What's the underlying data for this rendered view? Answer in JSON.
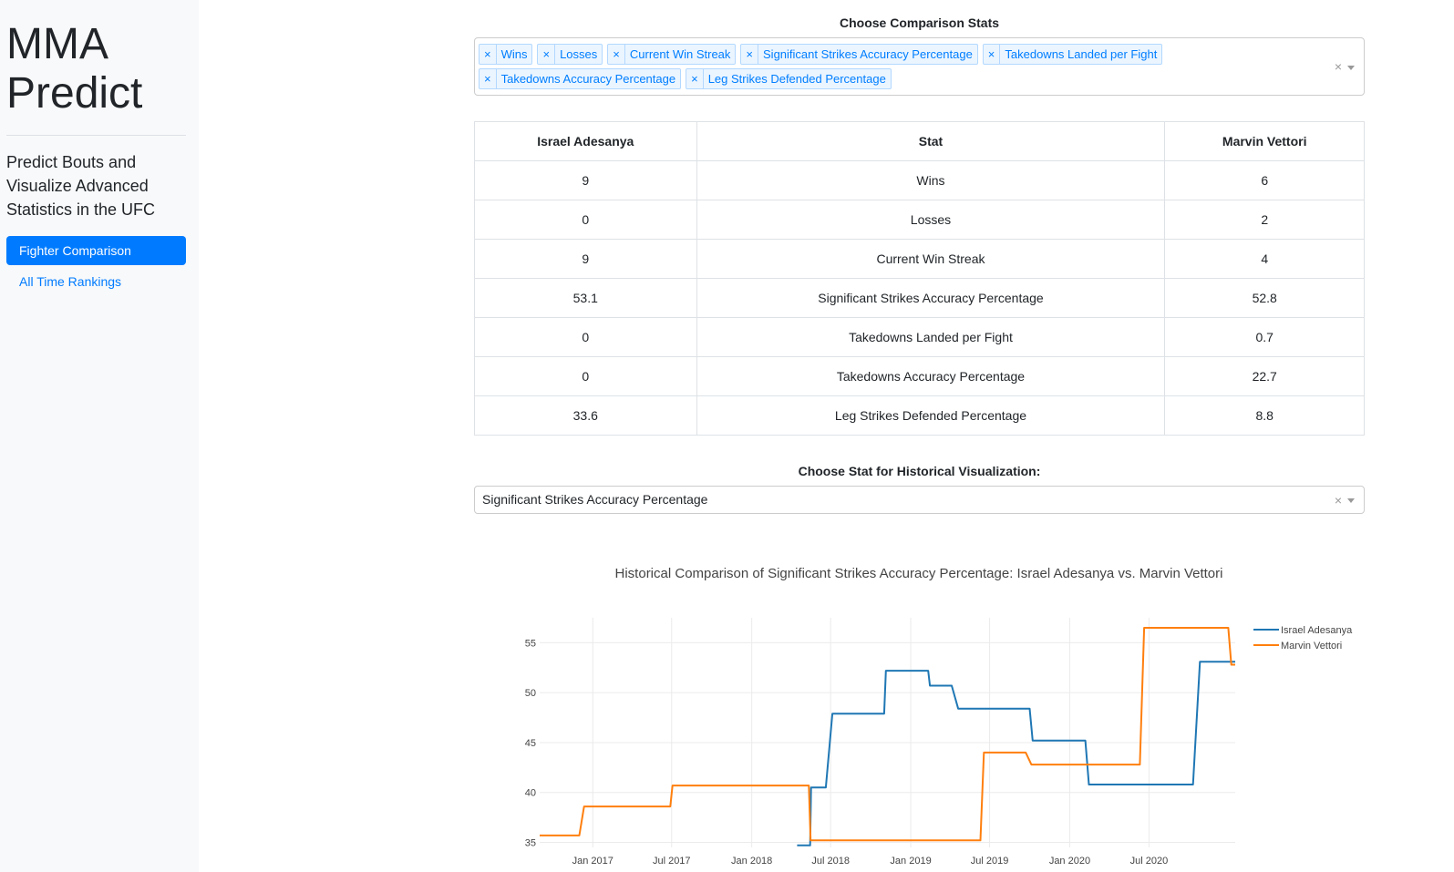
{
  "sidebar": {
    "title_line1": "MMA",
    "title_line2": "Predict",
    "tagline": "Predict Bouts and Visualize Advanced Statistics in the UFC",
    "nav": [
      {
        "label": "Fighter Comparison",
        "active": true
      },
      {
        "label": "All Time Rankings",
        "active": false
      }
    ]
  },
  "comparison": {
    "label": "Choose Comparison Stats",
    "selected": [
      "Wins",
      "Losses",
      "Current Win Streak",
      "Significant Strikes Accuracy Percentage",
      "Takedowns Landed per Fight",
      "Takedowns Accuracy Percentage",
      "Leg Strikes Defended Percentage"
    ],
    "clear_icon": "×"
  },
  "table": {
    "headers": [
      "Israel Adesanya",
      "Stat",
      "Marvin Vettori"
    ],
    "rows": [
      [
        "9",
        "Wins",
        "6"
      ],
      [
        "0",
        "Losses",
        "2"
      ],
      [
        "9",
        "Current Win Streak",
        "4"
      ],
      [
        "53.1",
        "Significant Strikes Accuracy Percentage",
        "52.8"
      ],
      [
        "0",
        "Takedowns Landed per Fight",
        "0.7"
      ],
      [
        "0",
        "Takedowns Accuracy Percentage",
        "22.7"
      ],
      [
        "33.6",
        "Leg Strikes Defended Percentage",
        "8.8"
      ]
    ]
  },
  "historical": {
    "label": "Choose Stat for Historical Visualization:",
    "selected": "Significant Strikes Accuracy Percentage"
  },
  "chart_data": {
    "type": "line",
    "title": "Historical Comparison of Significant Strikes Accuracy Percentage: Israel Adesanya vs. Marvin Vettori",
    "xlabel": "",
    "ylabel": "",
    "x_range": [
      "2016-09-01",
      "2021-01-15"
    ],
    "ylim": [
      34.5,
      57.5
    ],
    "x_ticks": [
      "Jan 2017",
      "Jul 2017",
      "Jan 2018",
      "Jul 2018",
      "Jan 2019",
      "Jul 2019",
      "Jan 2020",
      "Jul 2020"
    ],
    "y_ticks": [
      35,
      40,
      45,
      50,
      55
    ],
    "grid": true,
    "legend": "top-right",
    "series": [
      {
        "name": "Israel Adesanya",
        "color": "#1f77b4",
        "points": [
          [
            "2018-04-15",
            34.7
          ],
          [
            "2018-05-15",
            34.7
          ],
          [
            "2018-05-17",
            40.5
          ],
          [
            "2018-06-20",
            40.5
          ],
          [
            "2018-07-05",
            47.9
          ],
          [
            "2018-11-01",
            47.9
          ],
          [
            "2018-11-05",
            52.2
          ],
          [
            "2019-02-10",
            52.2
          ],
          [
            "2019-02-14",
            50.7
          ],
          [
            "2019-04-05",
            50.7
          ],
          [
            "2019-04-20",
            48.4
          ],
          [
            "2019-10-01",
            48.4
          ],
          [
            "2019-10-08",
            45.2
          ],
          [
            "2020-02-06",
            45.2
          ],
          [
            "2020-02-14",
            40.8
          ],
          [
            "2020-10-10",
            40.8
          ],
          [
            "2020-10-26",
            53.1
          ],
          [
            "2021-01-15",
            53.1
          ]
        ]
      },
      {
        "name": "Marvin Vettori",
        "color": "#ff7f0e",
        "points": [
          [
            "2016-09-01",
            35.7
          ],
          [
            "2016-12-01",
            35.7
          ],
          [
            "2016-12-12",
            38.6
          ],
          [
            "2017-06-28",
            38.6
          ],
          [
            "2017-07-03",
            40.7
          ],
          [
            "2018-05-12",
            40.7
          ],
          [
            "2018-05-16",
            35.2
          ],
          [
            "2019-06-10",
            35.2
          ],
          [
            "2019-06-18",
            44.0
          ],
          [
            "2019-09-22",
            44.0
          ],
          [
            "2019-10-05",
            42.8
          ],
          [
            "2020-06-10",
            42.8
          ],
          [
            "2020-06-20",
            56.5
          ],
          [
            "2020-12-30",
            56.5
          ],
          [
            "2021-01-06",
            52.8
          ],
          [
            "2021-01-15",
            52.8
          ]
        ]
      }
    ]
  }
}
